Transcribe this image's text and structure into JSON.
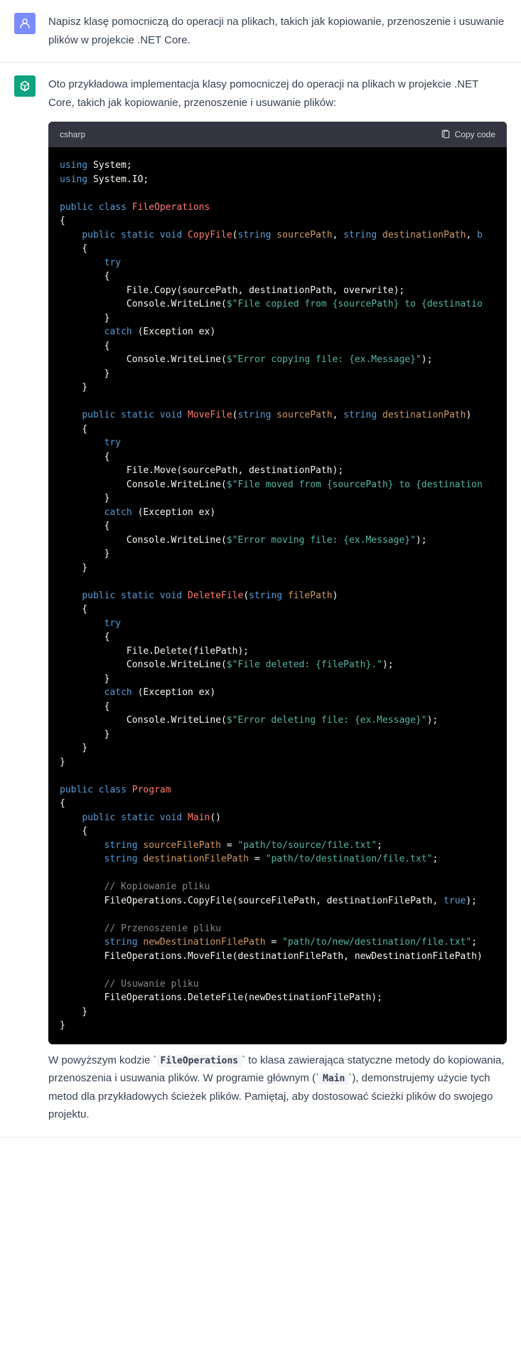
{
  "user_message": {
    "text": "Napisz klasę pomocniczą do operacji na plikach, takich jak kopiowanie, przenoszenie i usuwanie plików w projekcie .NET Core."
  },
  "assistant_message": {
    "intro": "Oto przykładowa implementacja klasy pomocniczej do operacji na plikach w projekcie .NET Core, takich jak kopiowanie, przenoszenie i usuwanie plików:",
    "code_lang": "csharp",
    "copy_label": "Copy code",
    "outro_parts": {
      "p1": "W powyższym kodzie ",
      "c1": "FileOperations",
      "p2": " to klasa zawierająca statyczne metody do kopiowania, przenoszenia i usuwania plików. W programie głównym (",
      "c2": "Main",
      "p3": "), demonstrujemy użycie tych metod dla przykładowych ścieżek plików. Pamiętaj, aby dostosować ścieżki plików do swojego projektu."
    }
  },
  "code": {
    "using1": "using",
    "system": " System;",
    "using2": "using",
    "systemio": " System.IO;",
    "public": "public",
    "class": "class",
    "fileops": "FileOperations",
    "static": "static",
    "void": "void",
    "copyfile": "CopyFile",
    "string": "string",
    "sourcePath": "sourcePath",
    "destinationPath": "destinationPath",
    "bool_overwrite": "b",
    "try": "try",
    "filecopy": "            File.Copy(sourcePath, destinationPath, overwrite);",
    "cw": "            Console.WriteLine(",
    "dollar": "$",
    "str_copied": "\"File copied from {sourcePath} to {destinatio",
    "catch": "catch",
    "exception": " (Exception ex)",
    "str_errcopy": "\"Error copying file: {ex.Message}\"",
    "movefile": "MoveFile",
    "filemove": "            File.Move(sourcePath, destinationPath);",
    "str_moved": "\"File moved from {sourcePath} to {destination",
    "str_errmove": "\"Error moving file: {ex.Message}\"",
    "deletefile": "DeleteFile",
    "filePath": "filePath",
    "filedelete": "            File.Delete(filePath);",
    "str_deleted": "\"File deleted: {filePath}.\"",
    "str_errdelete": "\"Error deleting file: {ex.Message}\"",
    "program": "Program",
    "main": "Main",
    "sourceFilePath": "sourceFilePath",
    "str_srcpath": "\"path/to/source/file.txt\"",
    "destinationFilePath": "destinationFilePath",
    "str_dstpath": "\"path/to/destination/file.txt\"",
    "cmt_copy": "// Kopiowanie pliku",
    "callcopy": "        FileOperations.CopyFile(sourceFilePath, destinationFilePath, ",
    "true": "true",
    "cmt_move": "// Przenoszenie pliku",
    "newDestinationFilePath": "newDestinationFilePath",
    "str_newdst": "\"path/to/new/destination/file.txt\"",
    "callmove": "        FileOperations.MoveFile(destinationFilePath, newDestinationFilePath)",
    "cmt_delete": "// Usuwanie pliku",
    "calldelete": "        FileOperations.DeleteFile(newDestinationFilePath);"
  }
}
